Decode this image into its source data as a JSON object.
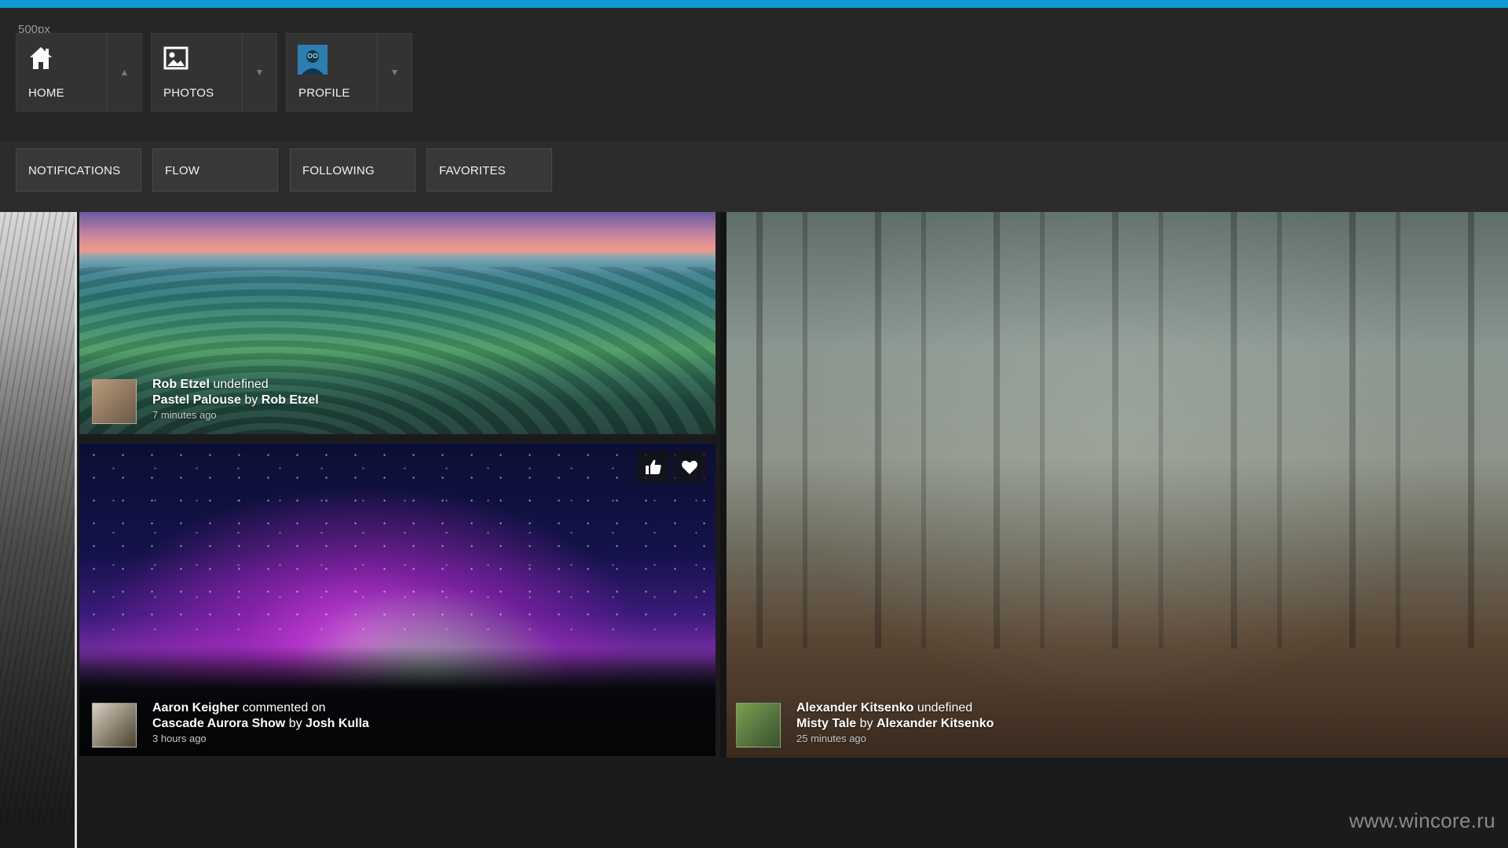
{
  "app": {
    "name": "500px",
    "accent_color": "#0f9bd7"
  },
  "nav": {
    "buttons": [
      {
        "label": "HOME",
        "icon": "home-icon",
        "caret": "▲"
      },
      {
        "label": "PHOTOS",
        "icon": "photo-icon",
        "caret": "▼"
      },
      {
        "label": "PROFILE",
        "icon": "profile-avatar-icon",
        "caret": "▼"
      }
    ]
  },
  "tabs": [
    "NOTIFICATIONS",
    "FLOW",
    "FOLLOWING",
    "FAVORITES"
  ],
  "feed": [
    {
      "actor": "Rob Etzel",
      "action": "undefined",
      "photo_title": "Pastel Palouse",
      "by": "by",
      "author": "Rob Etzel",
      "time": "7 minutes ago"
    },
    {
      "actor": "Aaron Keigher",
      "action": "commented on",
      "photo_title": "Cascade Aurora Show",
      "by": "by",
      "author": "Josh Kulla",
      "time": "3 hours ago",
      "actions": [
        "like-icon",
        "favorite-heart-icon"
      ]
    },
    {
      "actor": "Alexander Kitsenko",
      "action": "undefined",
      "photo_title": "Misty Tale",
      "by": "by",
      "author": "Alexander Kitsenko",
      "time": "25 minutes ago"
    }
  ],
  "watermark": "www.wincore.ru"
}
